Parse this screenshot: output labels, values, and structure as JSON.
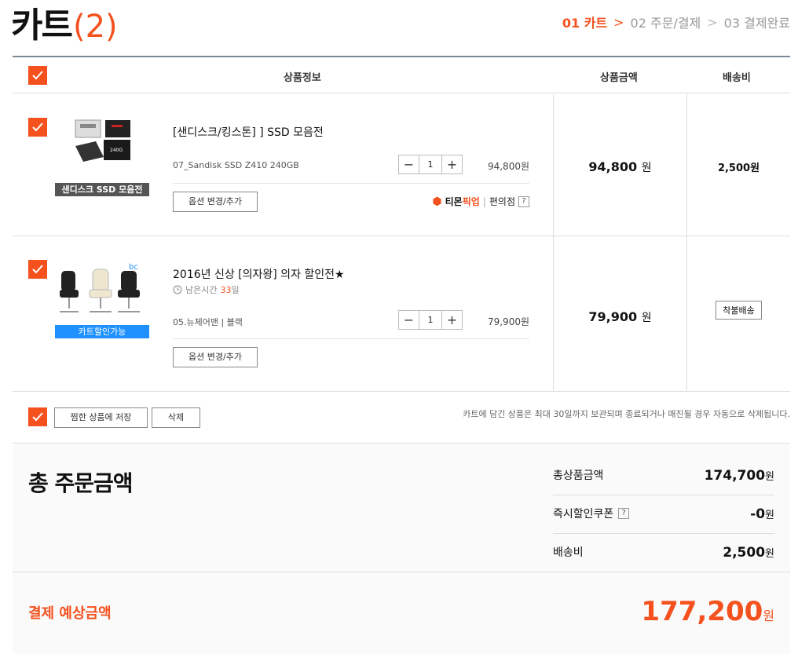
{
  "header": {
    "title": "카트",
    "count": "(2)",
    "steps": [
      {
        "label": "01 카트"
      },
      {
        "label": "02 주문/결제"
      },
      {
        "label": "03 결제완료"
      }
    ],
    "step_sep": ">"
  },
  "table_head": {
    "info": "상품정보",
    "price": "상품금액",
    "shipping": "배송비"
  },
  "items": [
    {
      "name": "[샌디스크/킹스톤] ] SSD 모음전",
      "thumb_caption": "샌디스크 SSD 모음전",
      "option": "07_Sandisk SSD Z410 240GB",
      "qty": "1",
      "unit_price": "94,800원",
      "option_button": "옵션 변경/추가",
      "pickup_brand_a": "티몬",
      "pickup_brand_b": "픽업",
      "pickup_store": "편의점",
      "price": "94,800",
      "price_unit": "원",
      "shipping": "2,500원"
    },
    {
      "name": "2016년 신상 [의자왕] 의자 할인전★",
      "thumb_caption": "카트할인가능",
      "remain_prefix": "남은시간",
      "remain_days": "33",
      "remain_suffix": "일",
      "option": "05.뉴체어맨 | 블랙",
      "qty": "1",
      "unit_price": "79,900원",
      "option_button": "옵션 변경/추가",
      "price": "79,900",
      "price_unit": "원",
      "shipping_tag": "착불배송"
    }
  ],
  "actions": {
    "save": "찜한 상품에 저장",
    "delete": "삭제",
    "notice": "카트에 담긴 상품은 최대 30일까지 보관되며 종료되거나 매진될 경우 자동으로 삭제됩니다."
  },
  "summary": {
    "title": "총 주문금액",
    "rows": [
      {
        "label": "총상품금액",
        "amount": "174,700",
        "unit": "원"
      },
      {
        "label": "즉시할인쿠폰",
        "amount": "-0",
        "unit": "원"
      },
      {
        "label": "배송비",
        "amount": "2,500",
        "unit": "원"
      }
    ]
  },
  "total": {
    "label": "결제 예상금액",
    "amount": "177,200",
    "unit": "원"
  },
  "colors": {
    "accent": "#f4511e",
    "blue": "#1e90ff"
  }
}
